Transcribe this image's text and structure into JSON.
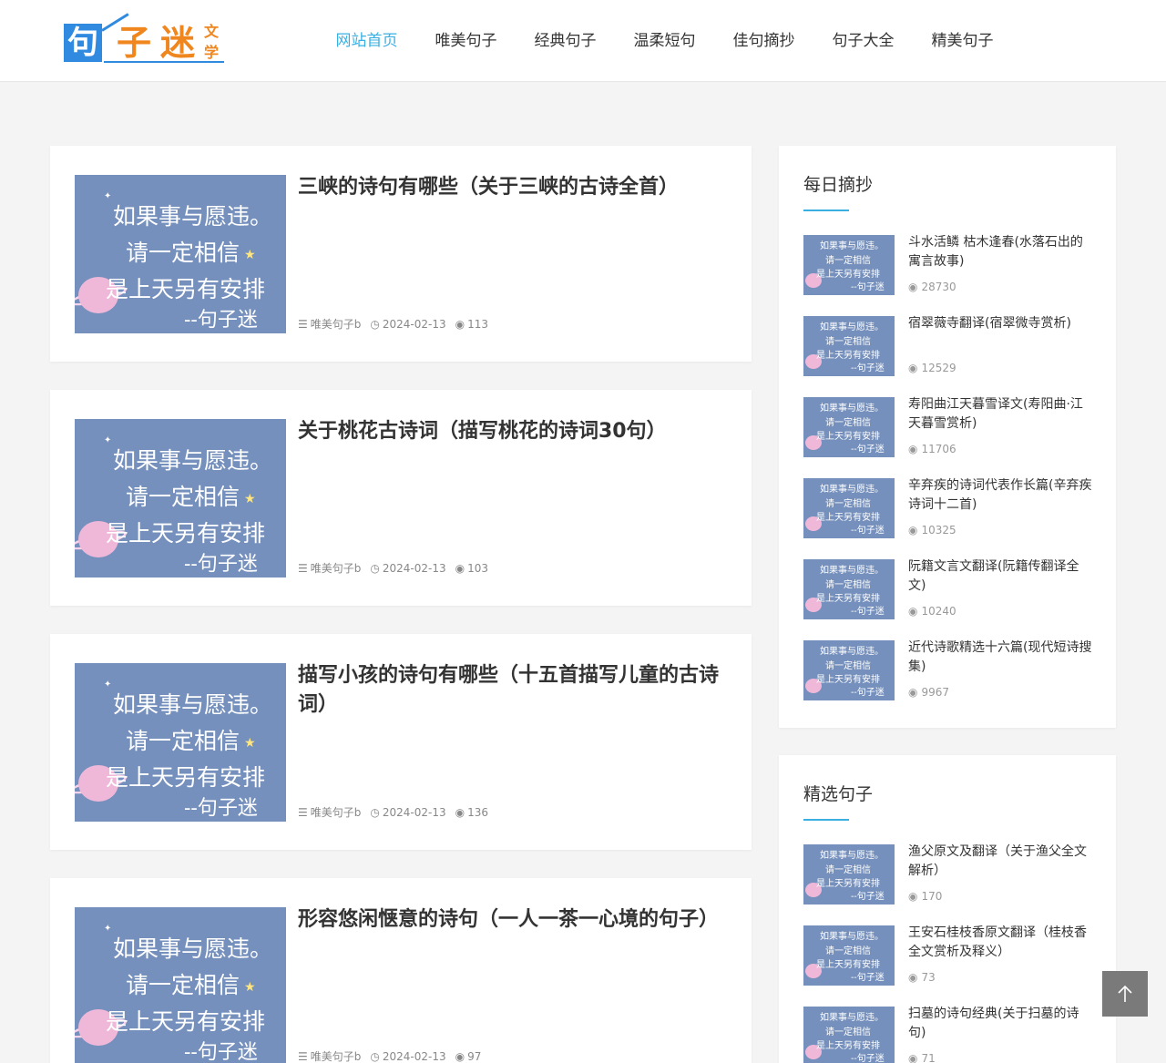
{
  "header": {
    "logo": {
      "main1": "句",
      "main2": "子",
      "main3": "迷",
      "small1": "文",
      "small2": "学"
    },
    "nav": [
      {
        "label": "网站首页",
        "active": true
      },
      {
        "label": "唯美句子",
        "active": false
      },
      {
        "label": "经典句子",
        "active": false
      },
      {
        "label": "温柔短句",
        "active": false
      },
      {
        "label": "佳句摘抄",
        "active": false
      },
      {
        "label": "句子大全",
        "active": false
      },
      {
        "label": "精美句子",
        "active": false
      }
    ]
  },
  "thumb": {
    "line1": "如果事与愿违。",
    "line2": "请一定相信",
    "line3": "是上天另有安排",
    "line4": "--句子迷"
  },
  "articles": [
    {
      "title": "三峡的诗句有哪些（关于三峡的古诗全首）",
      "category": "唯美句子b",
      "date": "2024-02-13",
      "views": "113"
    },
    {
      "title": "关于桃花古诗词（描写桃花的诗词30句）",
      "category": "唯美句子b",
      "date": "2024-02-13",
      "views": "103"
    },
    {
      "title": "描写小孩的诗句有哪些（十五首描写儿童的古诗词）",
      "category": "唯美句子b",
      "date": "2024-02-13",
      "views": "136"
    },
    {
      "title": "形容悠闲惬意的诗句（一人一茶一心境的句子）",
      "category": "唯美句子b",
      "date": "2024-02-13",
      "views": "97"
    }
  ],
  "daily": {
    "title": "每日摘抄",
    "items": [
      {
        "title": "斗水活鳞 枯木逢春(水落石出的寓言故事)",
        "views": "28730"
      },
      {
        "title": "宿翠薇寺翻译(宿翠微寺赏析)",
        "views": "12529"
      },
      {
        "title": "寿阳曲江天暮雪译文(寿阳曲·江天暮雪赏析)",
        "views": "11706"
      },
      {
        "title": "辛弃疾的诗词代表作长篇(辛弃疾诗词十二首)",
        "views": "10325"
      },
      {
        "title": "阮籍文言文翻译(阮籍传翻译全文)",
        "views": "10240"
      },
      {
        "title": "近代诗歌精选十六篇(现代短诗搜集)",
        "views": "9967"
      }
    ]
  },
  "featured": {
    "title": "精选句子",
    "items": [
      {
        "title": "渔父原文及翻译（关于渔父全文解析）",
        "views": "170"
      },
      {
        "title": "王安石桂枝香原文翻译（桂枝香全文赏析及释义）",
        "views": "73"
      },
      {
        "title": "扫墓的诗句经典(关于扫墓的诗句)",
        "views": "71"
      }
    ]
  },
  "colors": {
    "accent": "#3ab0e2",
    "thumb_bg": "#7590bd",
    "logo_blue": "#2f8ae0",
    "logo_orange": "#f0861e"
  },
  "icons": {
    "category": "list-icon",
    "date": "clock-icon",
    "views": "eye-icon",
    "top": "arrow-up-icon"
  }
}
